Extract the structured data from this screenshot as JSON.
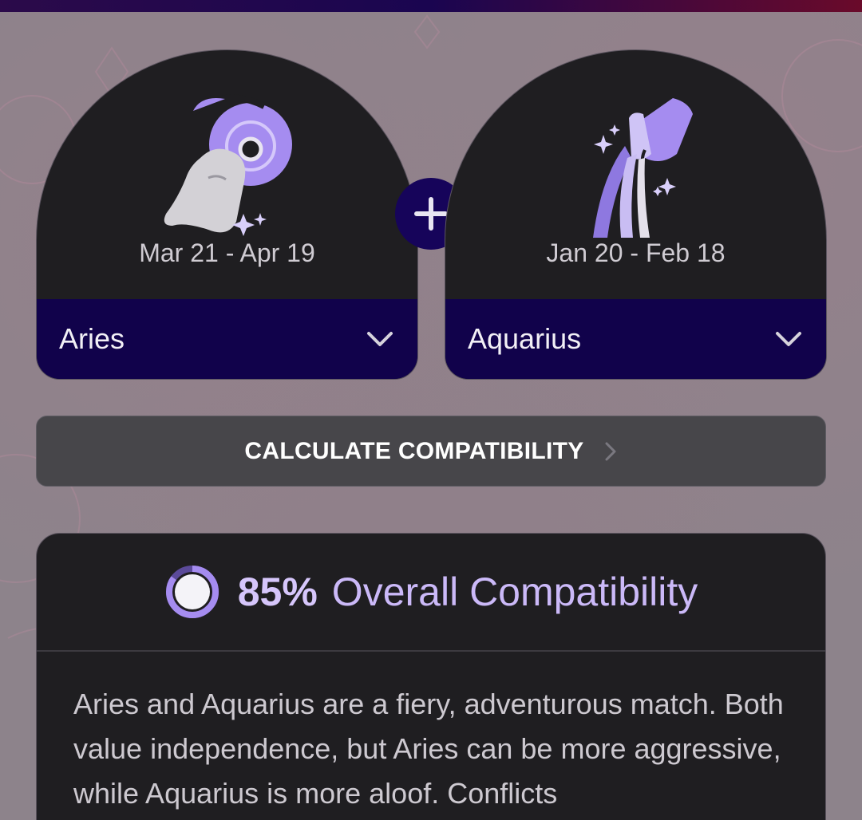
{
  "left_sign": {
    "icon": "aries-ram-icon",
    "dates": "Mar 21 - Apr 19",
    "selected": "Aries"
  },
  "right_sign": {
    "icon": "aquarius-water-bearer-icon",
    "dates": "Jan 20 - Feb 18",
    "selected": "Aquarius"
  },
  "plus_icon": "plus-icon",
  "calculate_button": "CALCULATE COMPATIBILITY",
  "result": {
    "percent": "85%",
    "percent_value": 0.85,
    "label": "Overall Compatibility",
    "description": "Aries and Aquarius are a fiery, adventurous match. Both value independence, but Aries can be more aggressive, while Aquarius is more aloof. Conflicts"
  },
  "colors": {
    "accent_purple": "#a58cf0",
    "select_bg": "#11024b",
    "card_bg": "#1f1e21"
  }
}
